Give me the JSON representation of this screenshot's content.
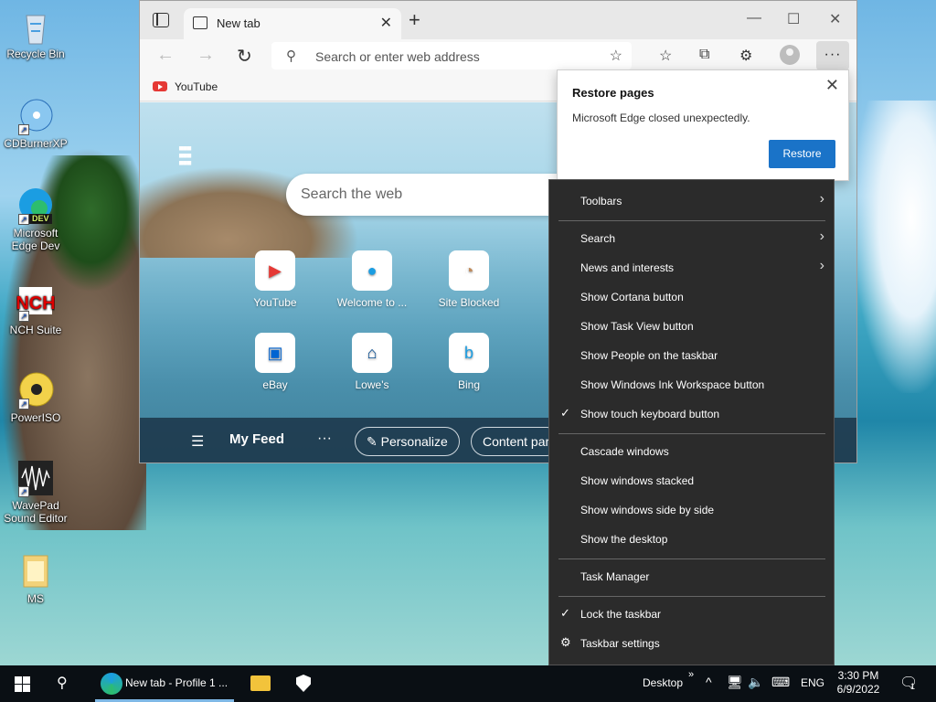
{
  "desktop": {
    "icons": [
      {
        "label": "Recycle Bin"
      },
      {
        "label": "CDBurnerXP"
      },
      {
        "label": "Microsoft Edge Dev",
        "badge": "DEV"
      },
      {
        "label": "NCH Suite"
      },
      {
        "label": "PowerISO"
      },
      {
        "label": "WavePad Sound Editor"
      },
      {
        "label": "MS"
      }
    ]
  },
  "browser": {
    "tab_title": "New tab",
    "address_placeholder": "Search or enter web address",
    "favorites_bar": [
      {
        "label": "YouTube"
      }
    ],
    "ntp": {
      "search_placeholder": "Search the web",
      "tiles": [
        {
          "label": "YouTube",
          "icon": "youtube-icon"
        },
        {
          "label": "Welcome to ...",
          "icon": "edge-icon"
        },
        {
          "label": "Site Blocked",
          "icon": "site-blocked-icon"
        },
        {
          "label": "eBay",
          "icon": "ebay-icon"
        },
        {
          "label": "Lowe's",
          "icon": "lowes-icon"
        },
        {
          "label": "Bing",
          "icon": "bing-icon"
        }
      ],
      "feed_label": "My Feed",
      "personalize_label": "Personalize",
      "content_label": "Content par"
    }
  },
  "restore_popup": {
    "title": "Restore pages",
    "message": "Microsoft Edge closed unexpectedly.",
    "button": "Restore"
  },
  "context_menu": {
    "items": [
      {
        "label": "Toolbars",
        "submenu": true,
        "checked": false
      },
      {
        "label": "Search",
        "submenu": true,
        "checked": false
      },
      {
        "label": "News and interests",
        "submenu": true,
        "checked": false
      },
      {
        "label": "Show Cortana button",
        "submenu": false,
        "checked": false
      },
      {
        "label": "Show Task View button",
        "submenu": false,
        "checked": false
      },
      {
        "label": "Show People on the taskbar",
        "submenu": false,
        "checked": false
      },
      {
        "label": "Show Windows Ink Workspace button",
        "submenu": false,
        "checked": false
      },
      {
        "label": "Show touch keyboard button",
        "submenu": false,
        "checked": true
      },
      {
        "label": "Cascade windows",
        "submenu": false,
        "checked": false
      },
      {
        "label": "Show windows stacked",
        "submenu": false,
        "checked": false
      },
      {
        "label": "Show windows side by side",
        "submenu": false,
        "checked": false
      },
      {
        "label": "Show the desktop",
        "submenu": false,
        "checked": false
      },
      {
        "label": "Task Manager",
        "submenu": false,
        "checked": false
      },
      {
        "label": "Lock the taskbar",
        "submenu": false,
        "checked": true
      },
      {
        "label": "Taskbar settings",
        "submenu": false,
        "checked": false,
        "icon": "gear-icon"
      }
    ]
  },
  "taskbar": {
    "edge_window_label": "New tab - Profile 1 ...",
    "desktop_label": "Desktop",
    "language": "ENG",
    "time": "3:30 PM",
    "date": "6/9/2022",
    "notification_count": "1",
    "colors": {
      "background": "#0a0f14",
      "accent": "#1a73c8"
    }
  }
}
